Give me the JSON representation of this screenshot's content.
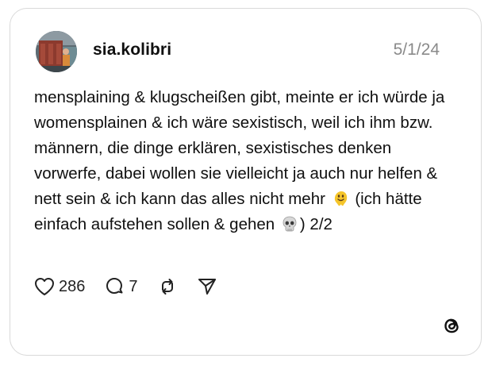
{
  "post": {
    "username": "sia.kolibri",
    "date": "5/1/24",
    "text_part1": "mensplaining & klugscheißen gibt, meinte er ich würde ja womensplainen & ich wäre sexistisch, weil ich ihm bzw. männern, die dinge erklären, sexistisches denken vorwerfe, dabei wollen sie vielleicht ja auch nur helfen & nett sein & ich kann das alles nicht mehr",
    "emoji1": "melting-face-emoji",
    "text_part2": "(ich hätte einfach aufstehen sollen & gehen",
    "emoji2": "skull-emoji",
    "text_part3": ") 2/2"
  },
  "actions": {
    "like_count": "286",
    "reply_count": "7",
    "repost_icon": "repost-icon",
    "share_icon": "share-icon"
  },
  "brand": {
    "logo": "threads-logo-icon"
  }
}
